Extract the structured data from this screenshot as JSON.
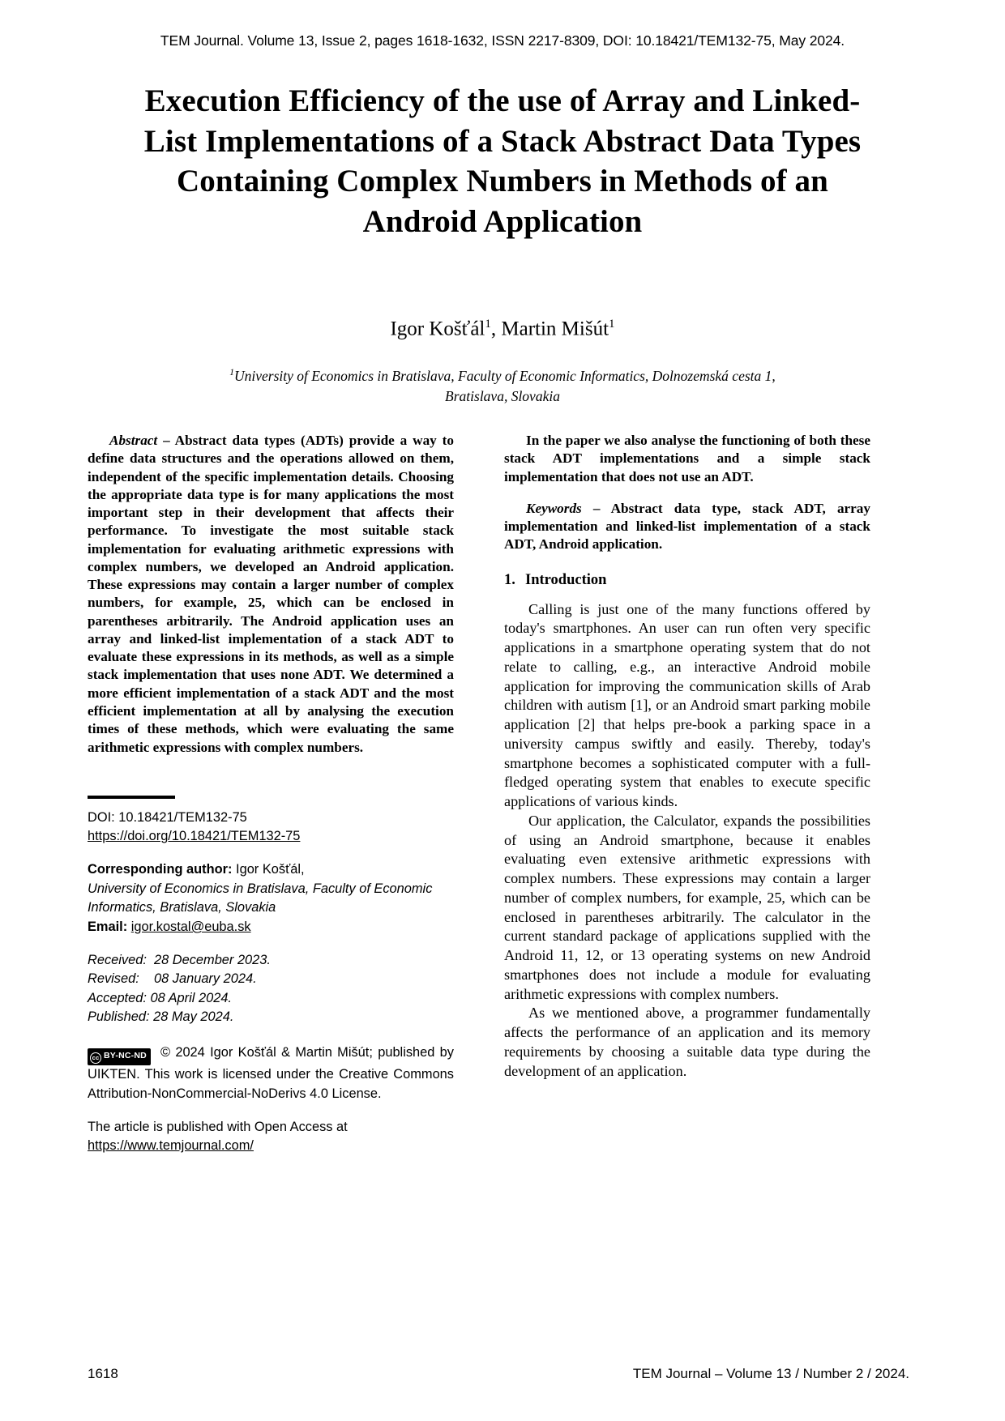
{
  "running_head": "TEM Journal. Volume 13, Issue 2, pages 1618-1632, ISSN 2217-8309, DOI: 10.18421/TEM132-75, May 2024.",
  "title": "Execution Efficiency of the use of Array and Linked-List Implementations of a Stack Abstract Data Types Containing Complex Numbers in Methods of an Android Application",
  "authors": {
    "name_1": "Igor Košťál",
    "sup_1": "1",
    "separator": ", ",
    "name_2": "Martin Mišút",
    "sup_2": "1"
  },
  "affiliation": {
    "marker": "1",
    "line_1": "University of Economics in Bratislava, Faculty of Economic Informatics, Dolnozemská cesta 1,",
    "line_2": "Bratislava, Slovakia"
  },
  "abstract": {
    "label": "Abstract",
    "dash": " – ",
    "text": "Abstract data types (ADTs) provide a way to define data structures and the operations allowed on them, independent of the specific implementation details. Choosing the appropriate data type is for many applications the most important step in their development that affects their performance. To investigate the most suitable stack implementation for evaluating arithmetic expressions with complex numbers, we developed an Android application. These expressions may contain a larger number of complex numbers, for example, 25, which can be enclosed in parentheses arbitrarily. The Android application uses an array and linked-list implementation of a stack ADT to evaluate these expressions in its methods, as well as a simple stack implementation that uses none ADT. We determined a more efficient implementation of a stack ADT and the most efficient implementation at all by analysing the execution times of these methods, which were evaluating the same arithmetic expressions with complex numbers.",
    "text_continued": "In the paper we also analyse the functioning of both these stack ADT implementations and a simple stack implementation that does not use an ADT."
  },
  "keywords": {
    "label": "Keywords",
    "dash": " – ",
    "text": "Abstract data type, stack ADT, array implementation and linked-list implementation of a stack ADT, Android application."
  },
  "metadata": {
    "doi_label": "DOI: 10.18421/TEM132-75",
    "doi_url": "https://doi.org/10.18421/TEM132-75",
    "corresponding_label": "Corresponding author:",
    "corresponding_name": " Igor Košťál,",
    "corresponding_affiliation_1": "University of Economics in Bratislava, Faculty of Economic",
    "corresponding_affiliation_2": "Informatics, Bratislava, Slovakia",
    "email_label": "Email:",
    "email_value": "igor.kostal@euba.sk",
    "dates": [
      "Received:  28 December 2023.",
      "Revised:    08 January 2024.",
      "Accepted: 08 April 2024.",
      "Published: 28 May 2024."
    ],
    "cc_badge_text": "BY-NC-ND",
    "cc_badge_symbol": "cc",
    "license_text": "© 2024 Igor Košťál & Martin Mišút; published by UIKTEN. This work is licensed under the Creative Commons Attribution-NonCommercial-NoDerivs 4.0 License.",
    "openaccess_text": "The article is published with Open Access at",
    "openaccess_url": "https://www.temjournal.com/"
  },
  "sections": [
    {
      "number": "1.",
      "heading": "Introduction",
      "paragraphs": [
        "Calling is just one of the many functions offered by today's smartphones. An user can run often very specific applications in a smartphone operating system that do not relate to calling, e.g., an interactive Android mobile application for improving the communication skills of Arab children with autism [1], or an Android smart parking mobile application [2] that helps pre-book a parking space in a university campus swiftly and easily. Thereby, today's smartphone becomes a sophisticated computer with a full-fledged operating system that enables to execute specific applications of various kinds.",
        "Our application, the Calculator, expands the possibilities of using an Android smartphone, because it enables evaluating even extensive arithmetic expressions with complex numbers. These expressions may contain a larger number of complex numbers, for example, 25, which can be enclosed in parentheses arbitrarily. The calculator in the current standard package of applications supplied with the Android 11, 12, or 13 operating systems on new Android smartphones does not include a module for evaluating arithmetic expressions with complex numbers.",
        "As we mentioned above, a programmer fundamentally affects the performance of an application and its memory requirements by choosing a suitable data type during the development of an application."
      ]
    }
  ],
  "footer": {
    "page_number": "1618",
    "journal_reference": "TEM Journal – Volume 13 / Number 2 / 2024."
  }
}
